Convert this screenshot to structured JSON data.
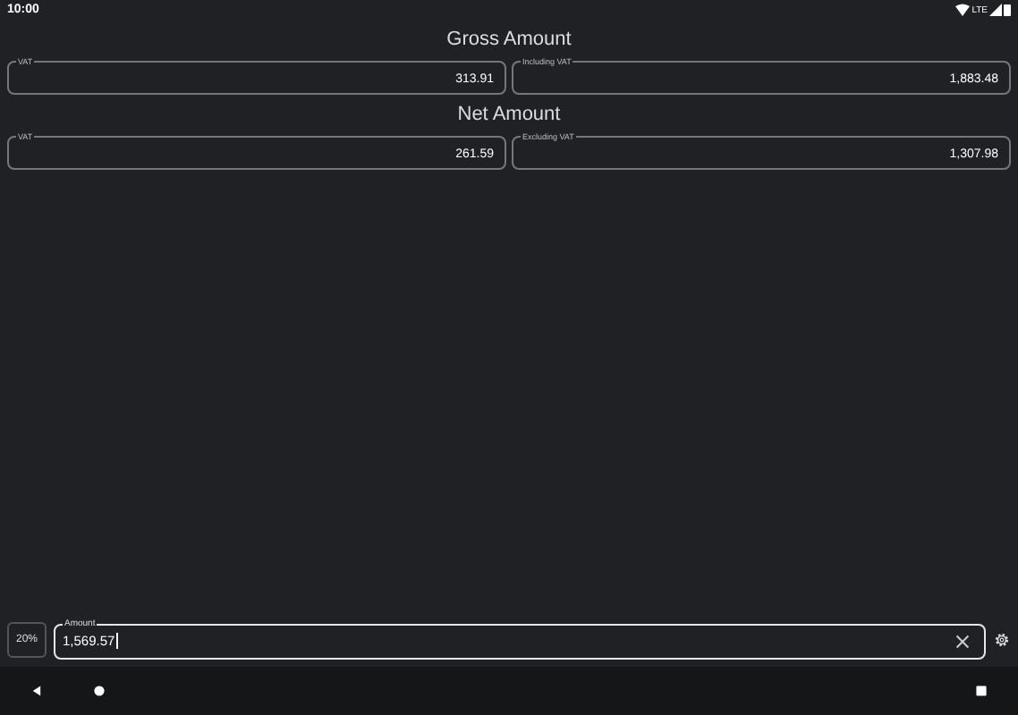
{
  "status_bar": {
    "time": "10:00",
    "network": "LTE"
  },
  "sections": [
    {
      "title": "Gross Amount",
      "fields": [
        {
          "label": "VAT",
          "value": "313.91"
        },
        {
          "label": "Including VAT",
          "value": "1,883.48"
        }
      ]
    },
    {
      "title": "Net Amount",
      "fields": [
        {
          "label": "VAT",
          "value": "261.59"
        },
        {
          "label": "Excluding VAT",
          "value": "1,307.98"
        }
      ]
    }
  ],
  "vat_rate": "20%",
  "amount_input": {
    "label": "Amount",
    "value": "1,569.57"
  }
}
